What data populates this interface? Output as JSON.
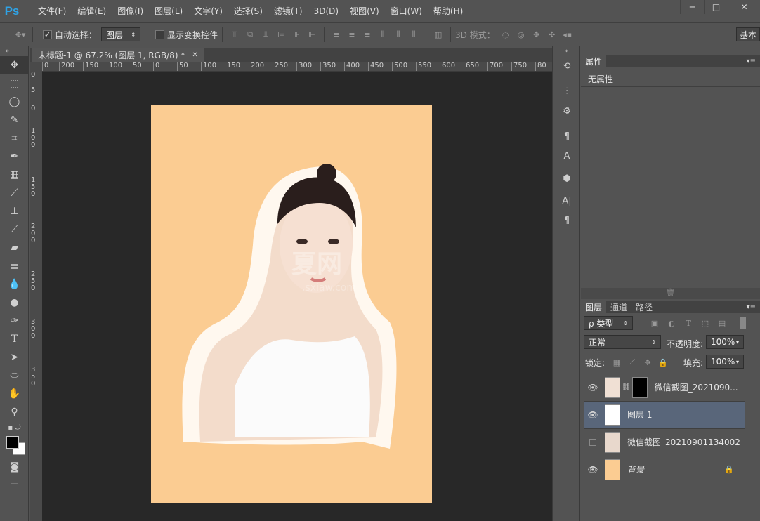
{
  "app": {
    "logo": "Ps"
  },
  "menu": [
    "文件(F)",
    "编辑(E)",
    "图像(I)",
    "图层(L)",
    "文字(Y)",
    "选择(S)",
    "滤镜(T)",
    "3D(D)",
    "视图(V)",
    "窗口(W)",
    "帮助(H)"
  ],
  "window_controls": [
    "─",
    "□",
    "✕"
  ],
  "options": {
    "auto_select_label": "自动选择：",
    "auto_select_checked": true,
    "target": "图层",
    "show_transform_label": "显示变换控件",
    "mode3d_label": "3D 模式：",
    "workspace": "基本"
  },
  "document": {
    "tab_title": "未标题-1 @ 67.2% (图层 1, RGB/8) *",
    "ruler_h": [
      "0",
      "200",
      "150",
      "100",
      "50",
      "0",
      "50",
      "100",
      "150",
      "200",
      "250",
      "300",
      "350",
      "400",
      "450",
      "500",
      "550",
      "600",
      "650",
      "700",
      "750",
      "80"
    ],
    "ruler_v": [
      "0",
      "5",
      "0",
      "1",
      "0",
      "0",
      "1",
      "5",
      "0",
      "2",
      "0",
      "0",
      "2",
      "5",
      "0",
      "3",
      "0",
      "0",
      "3",
      "5",
      "0"
    ],
    "watermark": "夏网",
    "watermark_url": ".sxiaw.com"
  },
  "properties": {
    "tab": "属性",
    "content": "无属性"
  },
  "layers_panel": {
    "tabs": [
      "图层",
      "通道",
      "路径"
    ],
    "filter": "ρ 类型",
    "blend_mode": "正常",
    "opacity_label": "不透明度:",
    "opacity": "100%",
    "lock_label": "锁定:",
    "fill_label": "填充:",
    "fill": "100%",
    "layers": [
      {
        "name": "微信截图_2021090...",
        "visible": true,
        "active": false,
        "masked": true
      },
      {
        "name": "图层 1",
        "visible": true,
        "active": true,
        "masked": false
      },
      {
        "name": "微信截图_20210901134002",
        "visible": false,
        "active": false,
        "masked": false
      },
      {
        "name": "背景",
        "visible": true,
        "active": false,
        "locked": true
      }
    ]
  },
  "colors": {
    "background": "#535353",
    "canvas": "#282828",
    "doc_fill": "#fbcc92",
    "active_layer": "#59667a",
    "accent": "#2fa3e6"
  }
}
